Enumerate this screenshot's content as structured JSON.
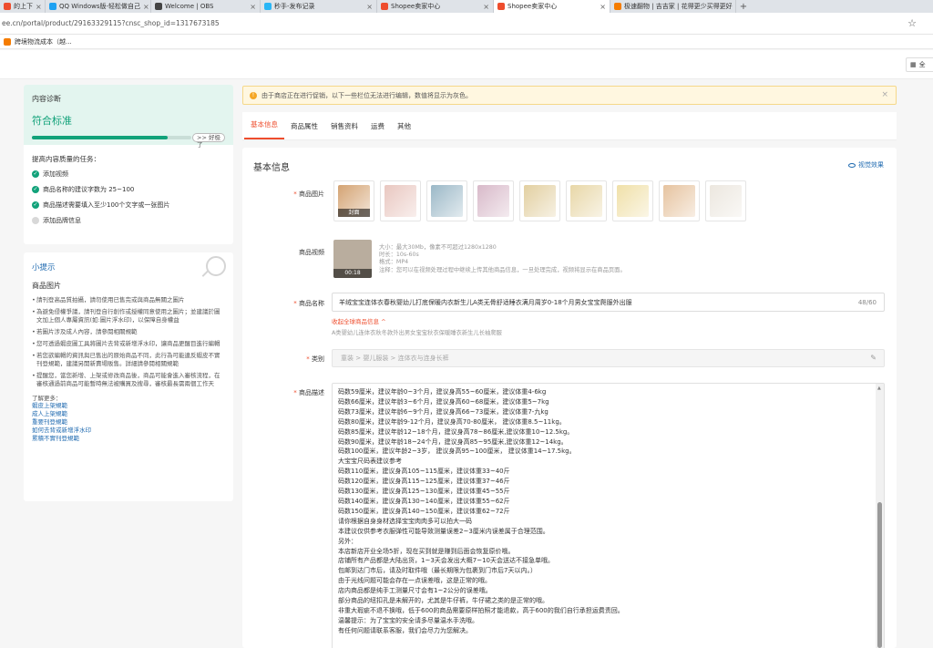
{
  "browser": {
    "tabs": [
      {
        "label": "的上下",
        "color": "#ee4d2d",
        "width": 50,
        "active": false
      },
      {
        "label": "QQ Windows版-轻松做自己",
        "color": "#1da1f2",
        "width": 116,
        "active": false
      },
      {
        "label": "Welcome | OBS",
        "color": "#444444",
        "width": 120,
        "active": false
      },
      {
        "label": "秒手-发布记录",
        "color": "#29b6f6",
        "width": 128,
        "active": false
      },
      {
        "label": "Shopee卖家中心",
        "color": "#ee4d2d",
        "width": 128,
        "active": false
      },
      {
        "label": "Shopee卖家中心",
        "color": "#ee4d2d",
        "width": 128,
        "active": true
      },
      {
        "label": "极速翻物 | 吉吉家 | 花得更少买得更好",
        "color": "#f57c00",
        "width": 138,
        "active": false
      }
    ],
    "url": "ee.cn/portal/product/29163329115?cnsc_shop_id=1317673185",
    "bookmark": "跨境物流成本（越..."
  },
  "shopbar": {
    "button_label": "全"
  },
  "diagnosis": {
    "title": "内容诊断",
    "status": "符合标准",
    "progress": 0.85,
    "badge": ">> 好极了",
    "tasks_title": "提高内容质量的任务：",
    "tasks": [
      {
        "label": "添加视频",
        "done": true
      },
      {
        "label": "商品名称的建议字数为 25~100",
        "done": true
      },
      {
        "label": "商品描述需要填入至少100个文字或一张图片",
        "done": true
      },
      {
        "label": "添加品牌信息",
        "done": false
      }
    ]
  },
  "tips": {
    "title": "小提示",
    "subtitle": "商品图片",
    "items": [
      "請刊登高品質拍攝，請勿使用已售完或與商品無關之圖片",
      "為避免侵權爭議，請刊登自行創作或授權同意使用之圖片；並建議於圖文加上個人專屬資訊(如:圖片浮水印)，以保障自身權益",
      "若圖片涉及成人內容，請參閱相關規範",
      "您可透過蝦皮圖工具將圖片去背或新增浮水印，讓商品更醒目進行編輯",
      "若您欲編輯的資訊與已售出的原始商品不同，此行為可能違反蝦皮不實刊登規範，建議另開新賣場販售。詳細請參閱相關規範",
      "提醒您，當您新增、上架或修改商品後，商品可能會進入審核流程，在審核通過前商品可能暫時無法被購買及搜尋，審核最長需兩個工作天"
    ],
    "more_title": "了解更多：",
    "links": [
      "蝦皮上架規範",
      "成人上架規範",
      "重要刊登規範",
      "如何去背或新增浮水印",
      "累積不實刊登規範"
    ]
  },
  "banner": {
    "text": "由于商店正在进行促销，以下一些栏位无法进行编辑，数值将显示为灰色。"
  },
  "nav": {
    "tabs": [
      "基本信息",
      "商品属性",
      "销售资料",
      "运费",
      "其他"
    ]
  },
  "form": {
    "section_title": "基本信息",
    "preview_label": "视觉效果",
    "images_label": "商品图片",
    "cover_tag": "封面",
    "image_colors": [
      "#d4a373",
      "#e9c7c0",
      "#9bb8c7",
      "#d8b9c9",
      "#e2cfa0",
      "#e8d7a7",
      "#f0e0a8",
      "#e6c39f",
      "#ece7df"
    ],
    "video_label": "商品视频",
    "video_time": "00:18",
    "video_info": [
      "大小：最大30Mb，像素不可超过1280x1280",
      "时长：10s-60s",
      "格式：MP4",
      "注释：您可以在视频处理过程中继续上传其他商品信息，一旦处理完成，视频将显示在商品页面。"
    ],
    "name_label": "商品名称",
    "name_value": "羊绒宝宝连体衣春秋婴幼儿打底保暖内衣新生儿A类无骨舒适睡衣满月周岁0-18个月男女宝宝爬服外出服",
    "name_count": "48/60",
    "lang_toggle": "收起全球商品信息 ^",
    "hint": "A类婴幼儿连体衣秋冬款外出男女宝宝秋衣保暖睡衣新生儿长袖爬服",
    "category_label": "类别",
    "category_value": "童装 > 婴儿服装 > 连体衣与连身长裤",
    "desc_label": "商品描述",
    "desc_lines": [
      "码数59厘米，建议年龄0~3个月，建议身高55~60厘米，建议体重4-6kg",
      "码数66厘米，建议年龄3~6个月，建议身高60~68厘米，建议体重5~7kg",
      "码数73厘米，建议年龄6~9个月，建议身高66~73厘米，建议体重7-九kg",
      "码数80厘米，建议年龄9-12个月，建议身高70-80厘米，  建议体重8.5~11kg。",
      "码数85厘米，建议年龄12~18个月，建议身高78~86厘米,建议体重10~12.5kg。",
      "码数90厘米，建议年龄18~24个月，建议身高85~95厘米,建议体重12~14kg。",
      "码数100厘米，建议年龄2~3岁， 建议身高95~100厘米， 建议体重14~17.5kg。",
      "大宝宝尺码表建议参考",
      " 码数110厘米，建议身高105~115厘米，建议体重33~40斤",
      " 码数120厘米，建议身高115~125厘米，建议体重37~46斤",
      " 码数130厘米，建议身高125~130厘米，建议体重45~55斤",
      " 码数140厘米，建议身高130~140厘米，建议体重55~62斤",
      " 码数150厘米，建议身高140~150厘米，建议体重62~72斤",
      "请你根据自身身材选择宝宝肉肉多可以拍大一码",
      "本建议仅供参考衣服弹性可能导致测量误差2~3厘米内误差属于合理范围。",
      "另外：",
      "本店新店开业全场5折，现在买到就是赚到后面会恢复原价哦。",
      "店铺所有产品都是大陆出货，1~3天会发出大概7~10天会送达不接急单哦。",
      "包邮到达门市后，请及时取件哦（最长期限为包裹到门市后7天以内。）",
      "由于光线问题可能会存在一点误差哦，这是正常的哦。",
      "店内商品都是纯手工测量尺寸会有1~2公分的误差哦。",
      "部分商品的纽扣孔是未解开的，尤其是牛仔裤，牛仔裙之类的是正常的哦。",
      "非重大瑕疵不退不换哦，低于600的商品需要原样拍照才能退款，高于600的我们自行承担运费责回。",
      "温馨提示：为了宝宝的安全请多尽量温水手洗哦。",
      "有任何问题请联系客服，我们会尽力为您解决。"
    ]
  }
}
